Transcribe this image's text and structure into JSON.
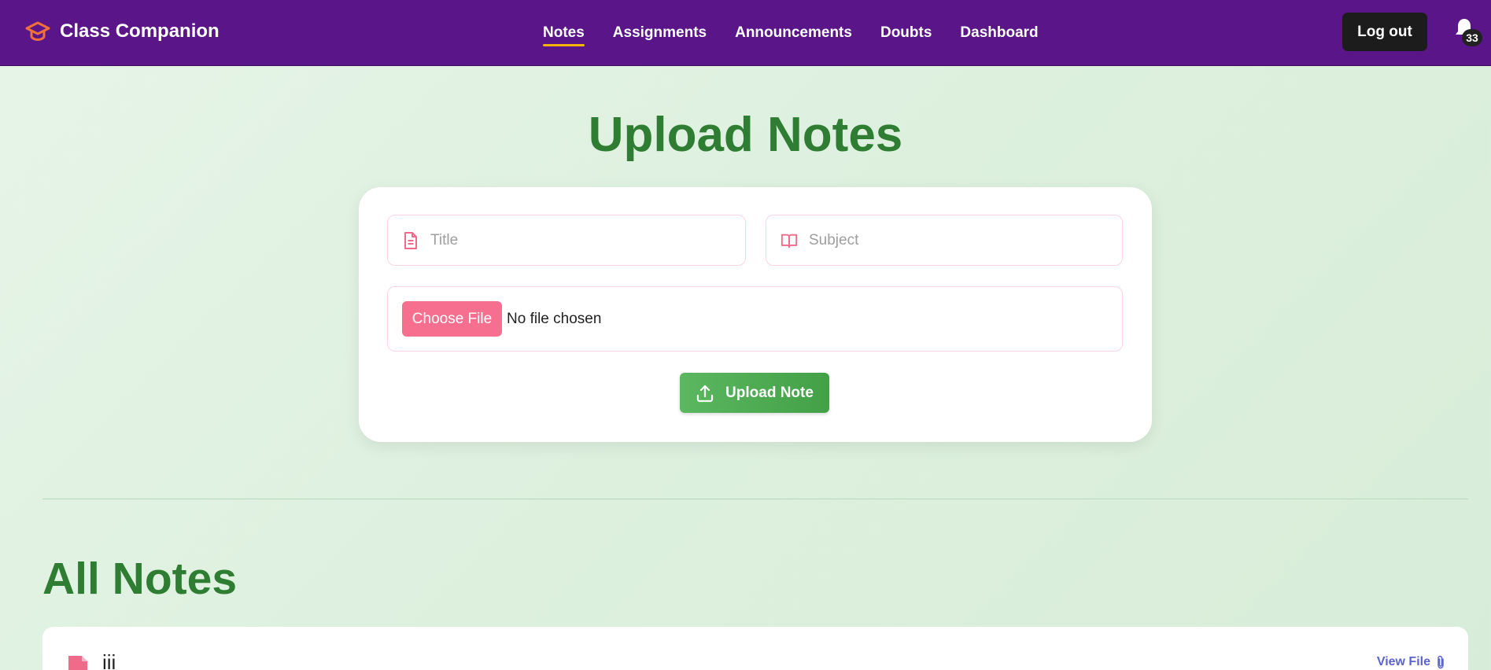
{
  "navbar": {
    "brand": "Class Companion",
    "brand_icon": "graduation-cap-icon",
    "links": [
      {
        "label": "Notes",
        "active": true
      },
      {
        "label": "Assignments",
        "active": false
      },
      {
        "label": "Announcements",
        "active": false
      },
      {
        "label": "Doubts",
        "active": false
      },
      {
        "label": "Dashboard",
        "active": false
      }
    ],
    "logout_label": "Log out",
    "notifications_count": "33"
  },
  "upload": {
    "heading": "Upload Notes",
    "title_placeholder": "Title",
    "subject_placeholder": "Subject",
    "choose_file_label": "Choose File",
    "no_file_text": "No file chosen",
    "upload_button_label": "Upload Note"
  },
  "notes": {
    "heading": "All Notes",
    "items": [
      {
        "title": "iii",
        "view_label": "View File"
      }
    ]
  },
  "colors": {
    "navbar_bg": "#5a1689",
    "accent_green": "#2e7d32",
    "accent_pink": "#f76f8e",
    "active_underline": "#f5b400",
    "link_blue": "#5b63d3"
  }
}
